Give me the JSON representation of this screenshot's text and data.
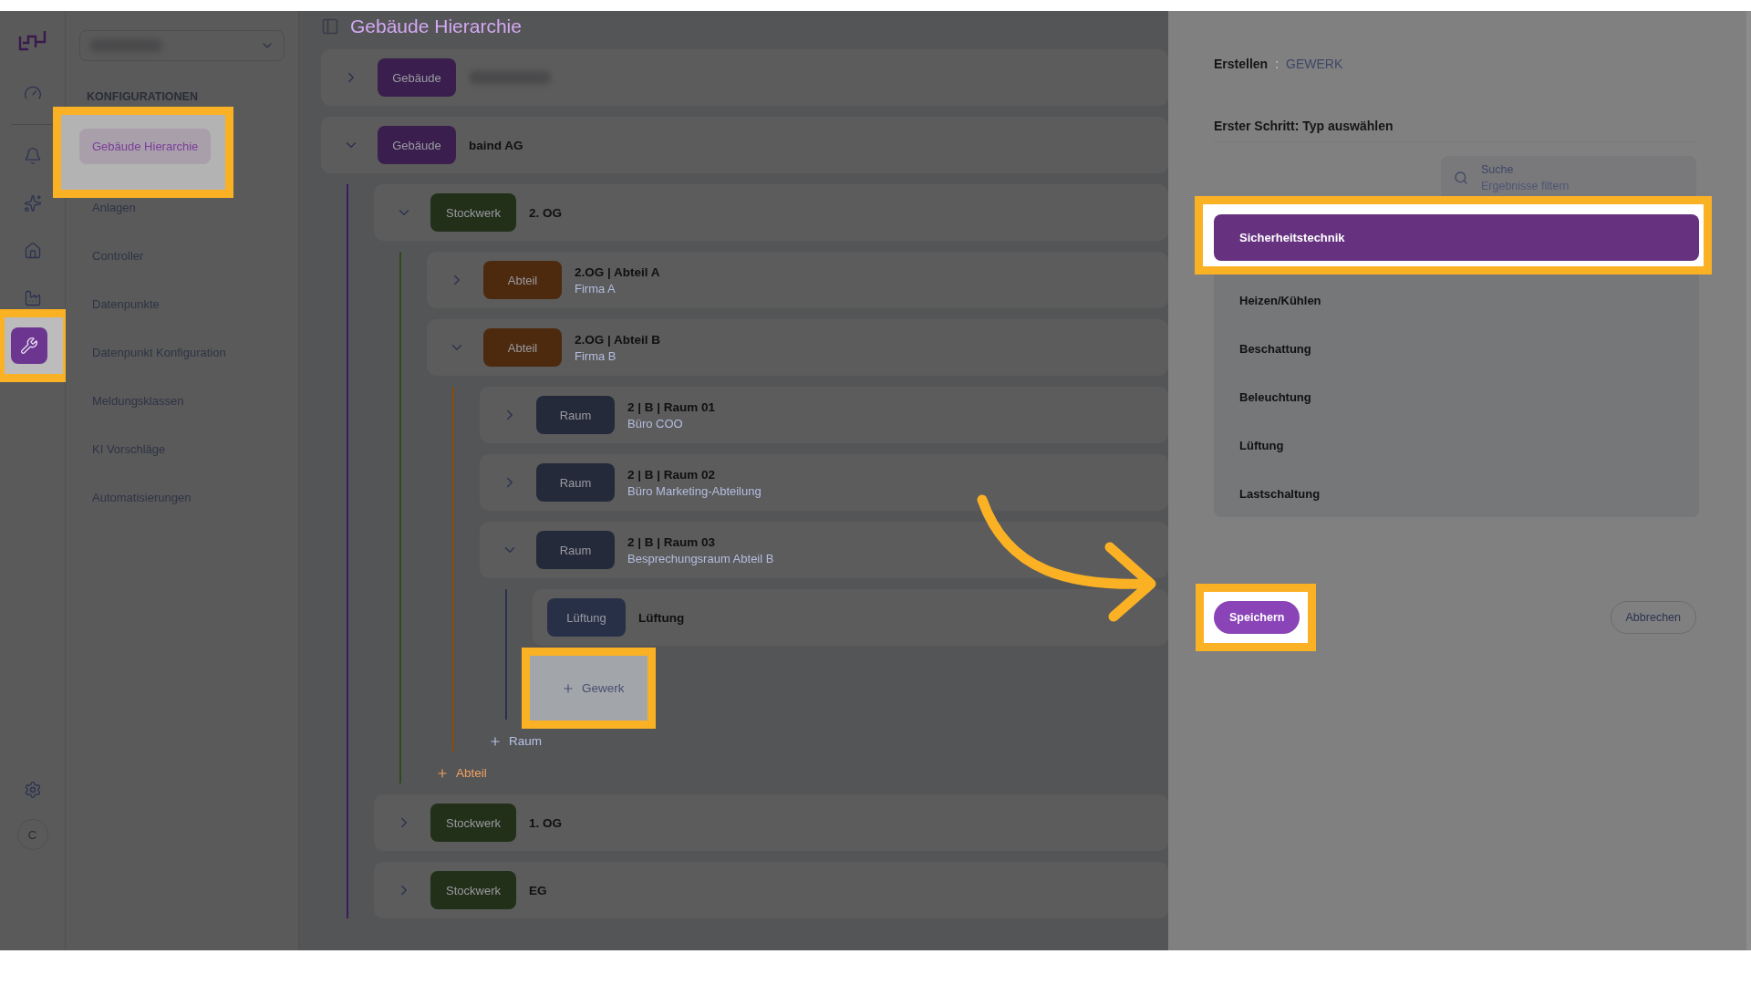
{
  "rail": {
    "items": [
      {
        "selected": false,
        "highlighted": false
      },
      {
        "selected": false,
        "highlighted": false
      },
      {
        "selected": false,
        "highlighted": false
      },
      {
        "selected": false,
        "highlighted": false
      },
      {
        "selected": false,
        "highlighted": false
      },
      {
        "selected": true,
        "highlighted": true
      }
    ],
    "avatar_initial": "C"
  },
  "nav": {
    "heading": "KONFIGURATIONEN",
    "items": [
      {
        "label": "Gebäude Hierarchie",
        "selected": true,
        "highlighted": true
      },
      {
        "label": "Anlagen",
        "selected": false,
        "highlighted": false
      },
      {
        "label": "Controller",
        "selected": false,
        "highlighted": false
      },
      {
        "label": "Datenpunkte",
        "selected": false,
        "highlighted": false
      },
      {
        "label": "Datenpunkt Konfiguration",
        "selected": false,
        "highlighted": false
      },
      {
        "label": "Meldungsklassen",
        "selected": false,
        "highlighted": false
      },
      {
        "label": "KI Vorschläge",
        "selected": false,
        "highlighted": false
      },
      {
        "label": "Automatisierungen",
        "selected": false,
        "highlighted": false
      }
    ]
  },
  "page_title": "Gebäude Hierarchie",
  "tree": [
    {
      "kind": "gebaeude",
      "badge": "Gebäude",
      "expanded": false
    },
    {
      "kind": "gebaeude",
      "badge": "Gebäude",
      "title": "baind AG",
      "expanded": true,
      "children": [
        {
          "kind": "stockwerk",
          "badge": "Stockwerk",
          "title": "2. OG",
          "expanded": true,
          "children": [
            {
              "kind": "abteil",
              "badge": "Abteil",
              "title": "2.OG | Abteil A",
              "subtitle": "Firma A",
              "expanded": false
            },
            {
              "kind": "abteil",
              "badge": "Abteil",
              "title": "2.OG | Abteil B",
              "subtitle": "Firma B",
              "expanded": true,
              "children": [
                {
                  "kind": "raum",
                  "badge": "Raum",
                  "title": "2 | B | Raum 01",
                  "subtitle": "Büro COO",
                  "expanded": false
                },
                {
                  "kind": "raum",
                  "badge": "Raum",
                  "title": "2 | B | Raum 02",
                  "subtitle": "Büro Marketing-Abteilung",
                  "expanded": false
                },
                {
                  "kind": "raum",
                  "badge": "Raum",
                  "title": "2 | B | Raum 03",
                  "subtitle": "Besprechungsraum Abteil B",
                  "expanded": true,
                  "children": [
                    {
                      "kind": "gewerk",
                      "badge": "Lüftung",
                      "title": "Lüftung"
                    }
                  ],
                  "add": {
                    "label": "Gewerk",
                    "kind": "gewerk",
                    "highlighted": true
                  }
                }
              ],
              "add": {
                "label": "Raum",
                "kind": "raum",
                "highlighted": false
              }
            }
          ],
          "add": {
            "label": "Abteil",
            "kind": "abteil",
            "highlighted": false
          }
        },
        {
          "kind": "stockwerk",
          "badge": "Stockwerk",
          "title": "1. OG",
          "expanded": false
        },
        {
          "kind": "stockwerk",
          "badge": "Stockwerk",
          "title": "EG",
          "expanded": false
        }
      ]
    }
  ],
  "drawer": {
    "breadcrumb": {
      "action": "Erstellen",
      "separator": ":",
      "target": "GEWERK"
    },
    "step_title": "Erster Schritt: Typ auswählen",
    "search": {
      "label": "Suche",
      "placeholder": "Ergebnisse filtern"
    },
    "options": [
      {
        "label": "Sicherheitstechnik",
        "selected": true,
        "highlighted": true
      },
      {
        "label": "Heizen/Kühlen",
        "selected": false,
        "highlighted": false
      },
      {
        "label": "Beschattung",
        "selected": false,
        "highlighted": false
      },
      {
        "label": "Beleuchtung",
        "selected": false,
        "highlighted": false
      },
      {
        "label": "Lüftung",
        "selected": false,
        "highlighted": false
      },
      {
        "label": "Lastschaltung",
        "selected": false,
        "highlighted": false
      }
    ],
    "save": {
      "label": "Speichern",
      "highlighted": true
    },
    "cancel": {
      "label": "Abbrechen"
    }
  }
}
